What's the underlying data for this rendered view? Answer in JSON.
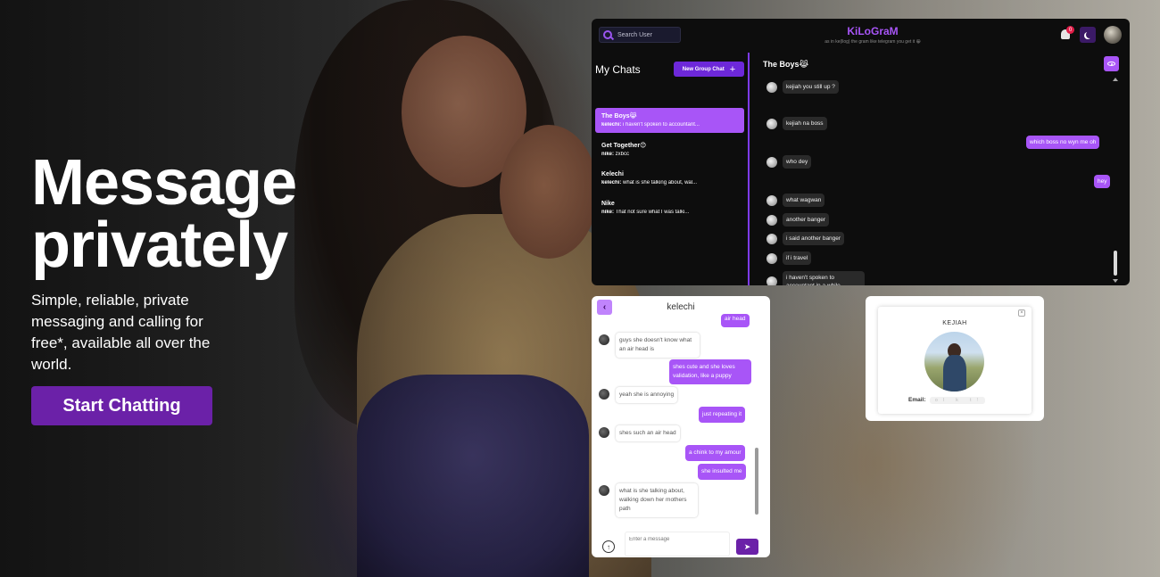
{
  "hero": {
    "title_line1": "Message",
    "title_line2": "privately",
    "subtitle": "Simple, reliable, private messaging and calling for free*, available all over the world.",
    "cta_label": "Start Chatting"
  },
  "desktop_app": {
    "search_placeholder": "Search User",
    "brand_name": "KiLoGraM",
    "brand_tagline": "as in ke(llog) the gram like telegram you get it 😀",
    "notification_count": "0",
    "my_chats_label": "My Chats",
    "new_group_label": "New Group Chat",
    "chats": [
      {
        "name": "The Boys😹",
        "sender": "kelechi:",
        "last": " i haven't spoken to accountant..."
      },
      {
        "name": "Get Together😊",
        "sender": "nike:",
        "last": " zxbcc"
      },
      {
        "name": "Kelechi",
        "sender": "kelechi:",
        "last": " what is she talking about, wal..."
      },
      {
        "name": "Nike",
        "sender": "nike:",
        "last": " That not sure what I was talki..."
      }
    ],
    "room_title": "The Boys😹",
    "messages": [
      {
        "text": "kejiah you still up ?",
        "dir": "in"
      },
      {
        "text": "kejiah na boss",
        "dir": "in"
      },
      {
        "text": "which boss no wyn me oh",
        "dir": "out"
      },
      {
        "text": "who dey",
        "dir": "in"
      },
      {
        "text": "hey",
        "dir": "out"
      },
      {
        "text": "what wagwan",
        "dir": "in"
      },
      {
        "text": "another banger",
        "dir": "in"
      },
      {
        "text": "i said another banger",
        "dir": "in"
      },
      {
        "text": "if i travel",
        "dir": "in"
      },
      {
        "text": "i haven't spoken to accountant in a while",
        "dir": "in"
      }
    ]
  },
  "mobile_chat": {
    "title": "kelechi",
    "back_glyph": "‹",
    "messages": [
      {
        "text": "air head",
        "dir": "out"
      },
      {
        "text": "guys she doesn't know what an air head is",
        "dir": "in"
      },
      {
        "text": "shes cute and she loves validation, like a puppy",
        "dir": "out"
      },
      {
        "text": "yeah she is annoying",
        "dir": "in"
      },
      {
        "text": "just repeating it",
        "dir": "out"
      },
      {
        "text": "shes such an air head",
        "dir": "in"
      },
      {
        "text": "a chink to my amour",
        "dir": "out"
      },
      {
        "text": "she insulted me",
        "dir": "out"
      },
      {
        "text": "what is she talking about, walking down her mothers path",
        "dir": "in"
      }
    ],
    "input_placeholder": "Enter a message",
    "upload_glyph": "↑",
    "send_glyph": "➤"
  },
  "profile_card": {
    "name": "KEJIAH",
    "email_label": "Email:",
    "email_value": "ol k t!",
    "close_glyph": "×"
  },
  "colors": {
    "accent": "#a855f7",
    "cta": "#6b21a8",
    "app_bg": "#0d0d0d"
  }
}
